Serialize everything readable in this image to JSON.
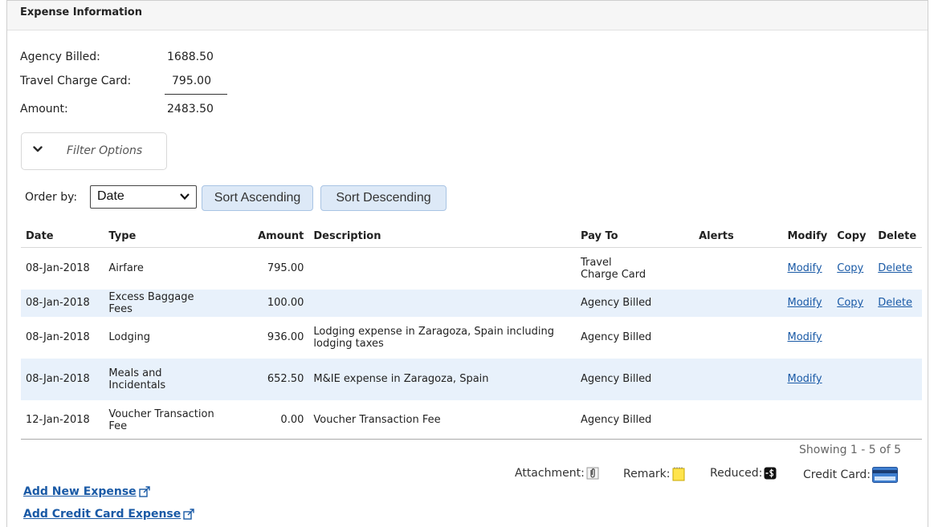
{
  "panel": {
    "title": "Expense Information"
  },
  "summary": {
    "agency_billed_label": "Agency Billed:",
    "agency_billed_value": "1688.50",
    "travel_card_label": "Travel Charge Card:",
    "travel_card_value": "795.00",
    "amount_label": "Amount:",
    "amount_value": "2483.50"
  },
  "filter": {
    "label": "Filter Options",
    "icon": "chevron-down-icon"
  },
  "sort": {
    "order_by_label": "Order by:",
    "order_by_value": "Date",
    "ascending_label": "Sort Ascending",
    "descending_label": "Sort Descending"
  },
  "table": {
    "headers": {
      "date": "Date",
      "type": "Type",
      "amount": "Amount",
      "description": "Description",
      "pay_to": "Pay To",
      "alerts": "Alerts",
      "modify": "Modify",
      "copy": "Copy",
      "delete": "Delete"
    },
    "rows": [
      {
        "date": "08-Jan-2018",
        "type": "Airfare",
        "amount": "795.00",
        "description": "",
        "pay_to_1": "Travel",
        "pay_to_2": "Charge Card",
        "modify": "Modify",
        "copy": "Copy",
        "delete": "Delete"
      },
      {
        "date": "08-Jan-2018",
        "type": "Excess Baggage Fees",
        "amount": "100.00",
        "description": "",
        "pay_to": "Agency Billed",
        "modify": "Modify",
        "copy": "Copy",
        "delete": "Delete"
      },
      {
        "date": "08-Jan-2018",
        "type": "Lodging",
        "amount": "936.00",
        "description_1": "Lodging expense in Zaragoza, Spain including",
        "description_2": "lodging taxes",
        "pay_to": "Agency Billed",
        "modify": "Modify"
      },
      {
        "date": "08-Jan-2018",
        "type_1": "Meals and",
        "type_2": "Incidentals",
        "amount": "652.50",
        "description": "M&IE expense in Zaragoza, Spain",
        "pay_to": "Agency Billed",
        "modify": "Modify"
      },
      {
        "date": "12-Jan-2018",
        "type_1": "Voucher Transaction",
        "type_2": "Fee",
        "amount": "0.00",
        "description": "Voucher Transaction Fee",
        "pay_to": "Agency Billed"
      }
    ]
  },
  "pagination": {
    "showing": "Showing 1 - 5 of 5"
  },
  "legend": {
    "attachment": "Attachment:",
    "remark": "Remark:",
    "reduced": "Reduced:",
    "credit_card": "Credit Card:"
  },
  "links": {
    "add_new_expense": "Add New Expense",
    "add_credit_card_expense": "Add Credit Card Expense"
  },
  "colors": {
    "link": "#1a5aa6",
    "row_alt": "#e8f1fb",
    "button_bg": "#dde9f7"
  }
}
